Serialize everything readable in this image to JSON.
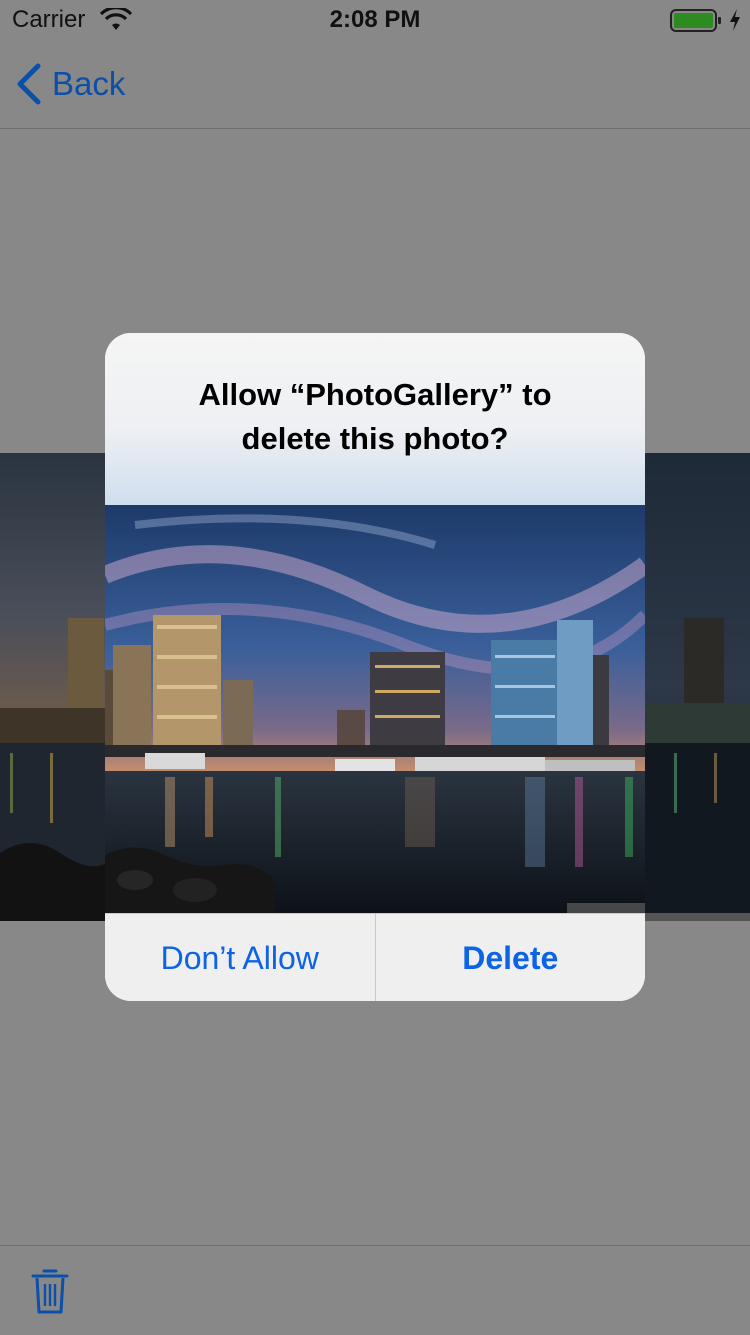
{
  "status_bar": {
    "carrier": "Carrier",
    "time": "2:08 PM"
  },
  "nav": {
    "back_label": "Back"
  },
  "alert": {
    "title_line1": "Allow “PhotoGallery” to",
    "title_line2": "delete this photo?",
    "deny_label": "Don’t Allow",
    "confirm_label": "Delete"
  },
  "icons": [
    "wifi-icon",
    "battery-icon",
    "charging-icon",
    "chevron-left-icon",
    "trash-icon"
  ],
  "colors": {
    "accent": "#0b63e5",
    "nav_tint": "#0b4fa8",
    "dim_background": "#888888"
  }
}
